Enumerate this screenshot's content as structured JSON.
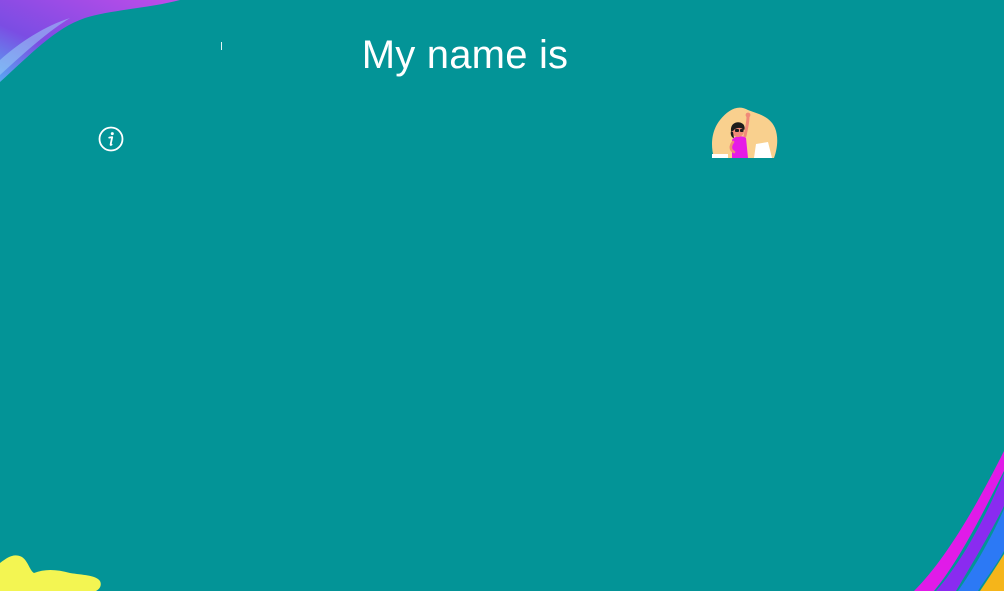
{
  "screen": {
    "background_color": "#039497",
    "prompt_heading": "My name is"
  },
  "info": {
    "icon": "info-icon",
    "color": "#ffffff"
  },
  "avatar": {
    "icon": "waving-person-illustration",
    "blob_color": "#F9D08E",
    "shirt_color": "#E61BE6"
  },
  "decorations": {
    "top_left_colors": [
      "#7B4DE3",
      "#C04BE9",
      "#58A8F2"
    ],
    "bottom_right_colors": [
      "#E01BE8",
      "#8A2BF0",
      "#2C79F5",
      "#F5B51A"
    ],
    "bottom_left_color": "#F3F552"
  }
}
